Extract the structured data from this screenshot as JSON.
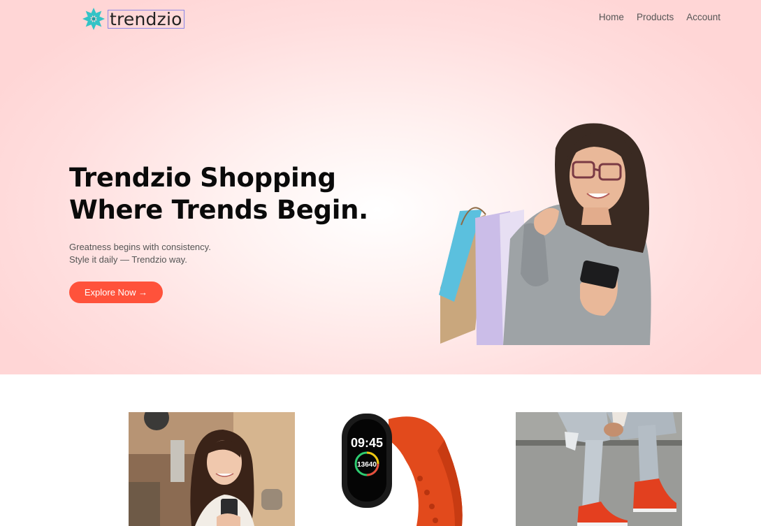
{
  "brand": {
    "name": "trendzio",
    "logo_icon": "snowflake-logo-icon",
    "accent": "#ff523b"
  },
  "nav": {
    "items": [
      "Home",
      "Products",
      "Account"
    ]
  },
  "hero": {
    "headline_line1": "Trendzio Shopping",
    "headline_line2": "Where Trends Begin.",
    "sub_line1": "Greatness begins with consistency.",
    "sub_line2": "Style it daily — Trendzio way.",
    "cta_label": "Explore Now →"
  },
  "products": [
    {
      "image": "woman-with-phone-photo"
    },
    {
      "image": "orange-smart-band-photo",
      "screen_time": "09:45",
      "screen_steps": "13640"
    },
    {
      "image": "red-sneakers-ripped-jeans-photo"
    }
  ]
}
